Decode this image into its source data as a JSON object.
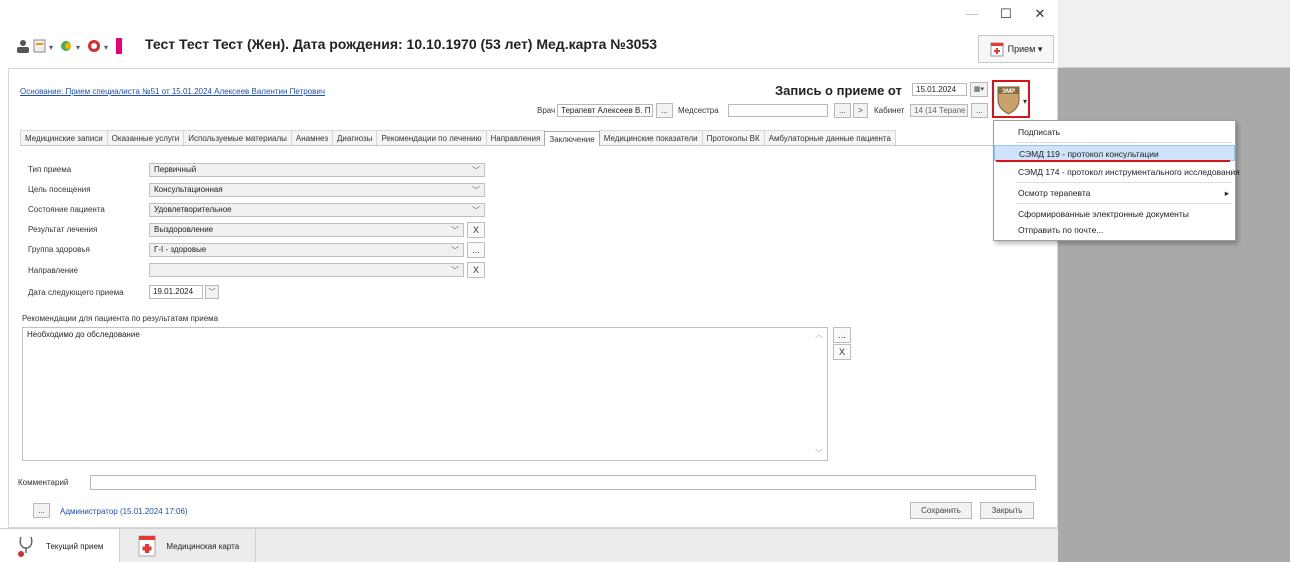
{
  "window": {
    "title": "Тест Тест Тест (Жен). Дата рождения: 10.10.1970 (53 лет) Мед.карта №3053",
    "minimize": "—",
    "maximize": "☐",
    "close": "✕",
    "priem_button": "Прием ▾"
  },
  "header": {
    "basis_link": "Основание: Прием специалиста №51 от 15.01.2024 Алексеев Валентин Петрович",
    "record_title": "Запись о приеме от",
    "record_date": "15.01.2024",
    "doctor_label": "Врач",
    "doctor_value": "Терапевт Алексеев В. П",
    "nurse_label": "Медсестра",
    "nurse_value": "",
    "cabinet_label": "Кабинет",
    "cabinet_value": "14 (14 Терапе",
    "ellipsis": "...",
    "next": ">",
    "ehr_badge": "ЭМР"
  },
  "tabs": [
    "Медицинские записи",
    "Оказанные услуги",
    "Используемые материалы",
    "Анамнез",
    "Диагнозы",
    "Рекомендации по лечению",
    "Направления",
    "Заключение",
    "Медицинские показатели",
    "Протоколы ВК",
    "Амбулаторные данные пациента"
  ],
  "form": {
    "visit_type_label": "Тип приема",
    "visit_type_value": "Первичный",
    "purpose_label": "Цель посещения",
    "purpose_value": "Консультационная",
    "state_label": "Состояние пациента",
    "state_value": "Удовлетворительное",
    "result_label": "Результат лечения",
    "result_value": "Выздоровление",
    "health_group_label": "Группа здоровья",
    "health_group_value": "Г-I - здоровые",
    "direction_label": "Направление",
    "direction_value": "",
    "next_visit_label": "Дата следующего приема",
    "next_visit_value": "19.01.2024",
    "recommendations_label": "Рекомендации для пациента по результатам приема",
    "recommendations_value": "Необходимо до обследование",
    "clear": "X",
    "ellipsis": "..."
  },
  "footer": {
    "comment_label": "Комментарий",
    "comment_value": "",
    "author": "Администратор (15.01.2024 17:06)",
    "ellipsis": "...",
    "save": "Сохранить",
    "close": "Закрыть"
  },
  "bottom_tabs": {
    "current": "Текущий прием",
    "card": "Медицинская карта"
  },
  "menu": {
    "items": [
      "Подписать",
      "СЭМД 119 - протокол консультации",
      "СЭМД 174 - протокол инструментального исследования",
      "Осмотр терапевта",
      "Сформированные электронные документы",
      "Отправить по почте..."
    ],
    "submenu_arrow": "▸"
  },
  "colors": {
    "highlight": "#d8141b",
    "link": "#1f4fb4",
    "menu_hover": "#cfe4fa"
  }
}
